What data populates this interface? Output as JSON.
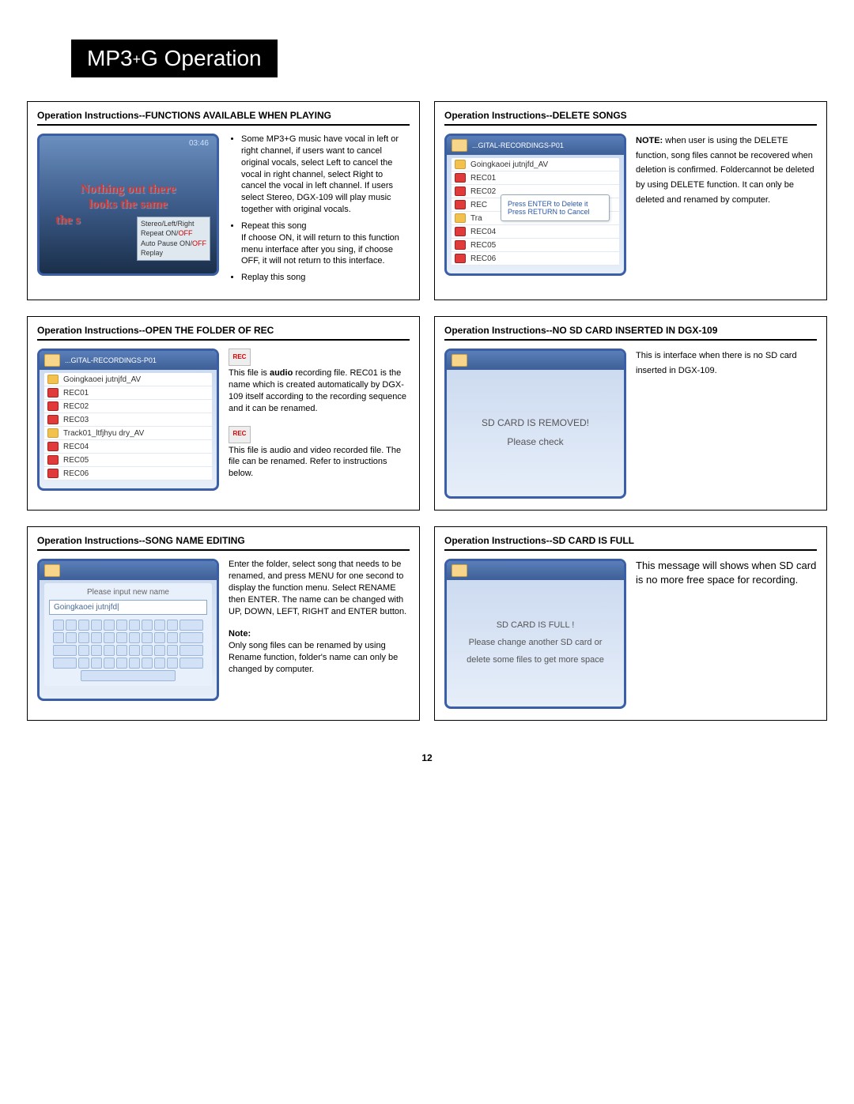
{
  "page": {
    "title_prefix": "MP3",
    "title_plus": "+",
    "title_suffix": "G Operation",
    "number": "12"
  },
  "panel1": {
    "title": "Operation Instructions--FUNCTIONS AVAILABLE WHEN PLAYING",
    "timecode": "03:46",
    "lyric1": "Nothing out there",
    "lyric2": "looks the same",
    "lyric3": "the s",
    "menu_item1": "Stereo/Left/Right",
    "menu_item2_a": "Repeat ON/",
    "menu_item2_b": "OFF",
    "menu_item3_a": "Auto Pause ON/",
    "menu_item3_b": "OFF",
    "menu_item4": "Replay",
    "bullet1": "Some MP3+G music have vocal in left or right channel, if users want to cancel original vocals, select Left to cancel the vocal in right channel, select Right to cancel the vocal in left channel. If users select Stereo, DGX-109 will play music together with original vocals.",
    "bullet2": "Repeat this song",
    "bullet2_sub": "If choose ON, it will return to this function menu interface after you sing, if choose OFF, it will not return to this interface.",
    "bullet3": "Replay this song"
  },
  "panel2": {
    "title": "Operation Instructions--DELETE SONGS",
    "folder_header": "...GITAL-RECORDINGS-P01",
    "rows": [
      "Goingkaoei jutnjfd_AV",
      "REC01",
      "REC02",
      "REC",
      "Tra",
      "REC04",
      "REC05",
      "REC06"
    ],
    "dialog_line1": "Press ENTER to Delete it",
    "dialog_line2": "Press RETURN to Cancel",
    "note_label": "NOTE:",
    "note_text": " when user is using the DELETE function, song files cannot be recovered when deletion is confirmed. Foldercannot be deleted by using DELETE function. It can only be deleted and renamed by computer."
  },
  "panel3": {
    "title": "Operation Instructions--OPEN THE FOLDER OF REC",
    "folder_header": "...GITAL-RECORDINGS-P01",
    "rows": [
      "Goingkaoei jutnjfd_AV",
      "REC01",
      "REC02",
      "REC03",
      "Track01_ltfjhyu dry_AV",
      "REC04",
      "REC05",
      "REC06"
    ],
    "rec_badge": "REC",
    "para1_lead": "This file is ",
    "para1_bold": "audio",
    "para1_rest": " recording file. REC01 is the name which is created automatically by DGX-109 itself according to the recording sequence and it can be renamed.",
    "para2": "This file is audio and video recorded file. The file can be renamed. Refer to instructions below."
  },
  "panel4": {
    "title": "Operation Instructions--NO SD CARD INSERTED IN DGX-109",
    "screen_line1": "SD CARD IS REMOVED!",
    "screen_line2": "Please check",
    "side": "This is interface when there is no SD card inserted in DGX-109."
  },
  "panel5": {
    "title": "Operation Instructions--SONG NAME EDITING",
    "prompt": "Please input new name",
    "inputval": "Goingkaoei jutnjfd|",
    "para": "Enter the folder, select song that needs to be renamed, and press MENU for one second to display the function menu. Select RENAME then ENTER. The name can be changed with UP, DOWN, LEFT, RIGHT and ENTER button.",
    "note_label": "Note:",
    "note_text": "Only song files can be renamed by using Rename function, folder's name can only be changed by computer."
  },
  "panel6": {
    "title": "Operation Instructions--SD CARD IS FULL",
    "screen_line1": "SD CARD IS FULL !",
    "screen_line2": "Please change another SD card or",
    "screen_line3": "delete some files to get more space",
    "side": "This message will shows when SD card is no more free space for recording."
  }
}
